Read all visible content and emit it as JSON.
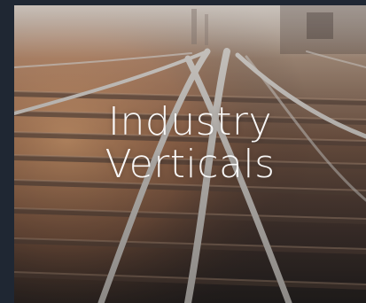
{
  "tile": {
    "title_line_1": "Industry",
    "title_line_2": "Verticals",
    "image_subject": "railway-tracks-photo"
  },
  "colors": {
    "page_background": "#1f2733",
    "caption_text": "#ffffff",
    "haze_warm": "#d9a27a",
    "rail_steel": "#c9c6c2"
  }
}
